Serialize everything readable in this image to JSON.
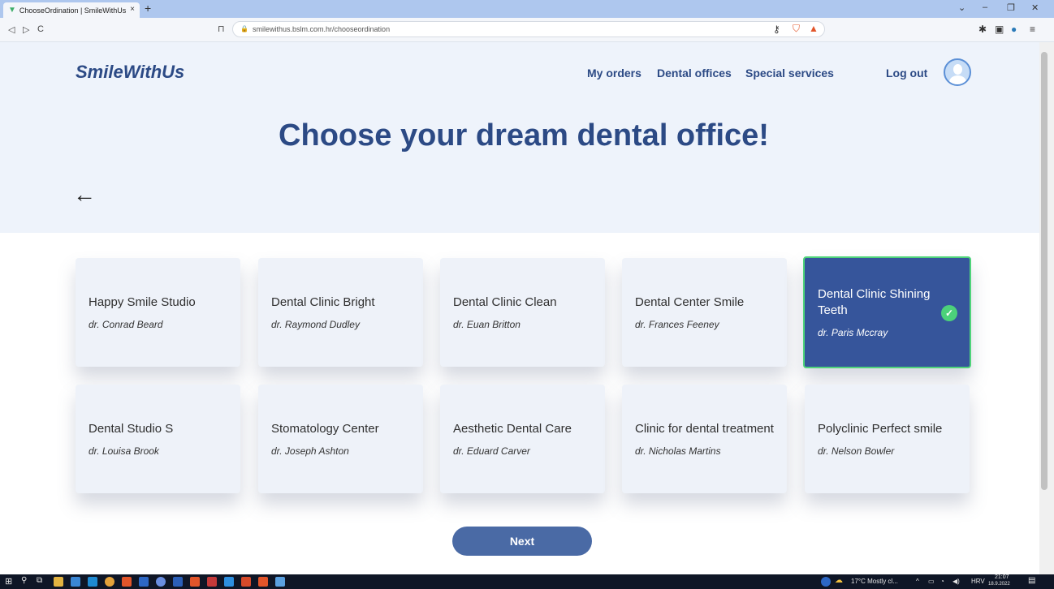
{
  "browser": {
    "tab_title": "ChooseOrdination | SmileWithUs",
    "tab_close": "×",
    "new_tab": "+",
    "url": "smilewithus.bslm.com.hr/chooseordination",
    "nav_back": "◁",
    "nav_forward": "▷",
    "nav_reload": "C"
  },
  "header": {
    "logo": "SmileWithUs",
    "nav_links": [
      "My orders",
      "Dental offices",
      "Special services"
    ],
    "logout": "Log out"
  },
  "main": {
    "title": "Choose your dream dental office!",
    "back_arrow": "←",
    "next_button": "Next"
  },
  "offices": [
    {
      "name": "Happy Smile Studio",
      "doctor": "dr. Conrad Beard"
    },
    {
      "name": "Dental Clinic Bright",
      "doctor": "dr. Raymond Dudley"
    },
    {
      "name": "Dental Clinic Clean",
      "doctor": "dr. Euan Britton"
    },
    {
      "name": "Dental Center Smile",
      "doctor": "dr. Frances Feeney"
    },
    {
      "name": "Dental Clinic Shining Teeth",
      "doctor": "dr. Paris Mccray",
      "selected": true
    },
    {
      "name": "Dental Studio S",
      "doctor": "dr. Louisa Brook"
    },
    {
      "name": "Stomatology Center",
      "doctor": "dr. Joseph Ashton"
    },
    {
      "name": "Aesthetic Dental Care",
      "doctor": "dr. Eduard Carver"
    },
    {
      "name": "Clinic for dental treatment",
      "doctor": "dr. Nicholas Martins"
    },
    {
      "name": "Polyclinic Perfect smile",
      "doctor": "dr. Nelson Bowler"
    }
  ],
  "taskbar": {
    "weather": "17°C Mostly cl...",
    "language": "HRV",
    "time": "21:07",
    "date": "18.9.2022"
  },
  "colors": {
    "brand": "#2c4a85",
    "selected_card": "#36559b",
    "selected_border": "#4fd47a",
    "button": "#4a6aa5"
  }
}
